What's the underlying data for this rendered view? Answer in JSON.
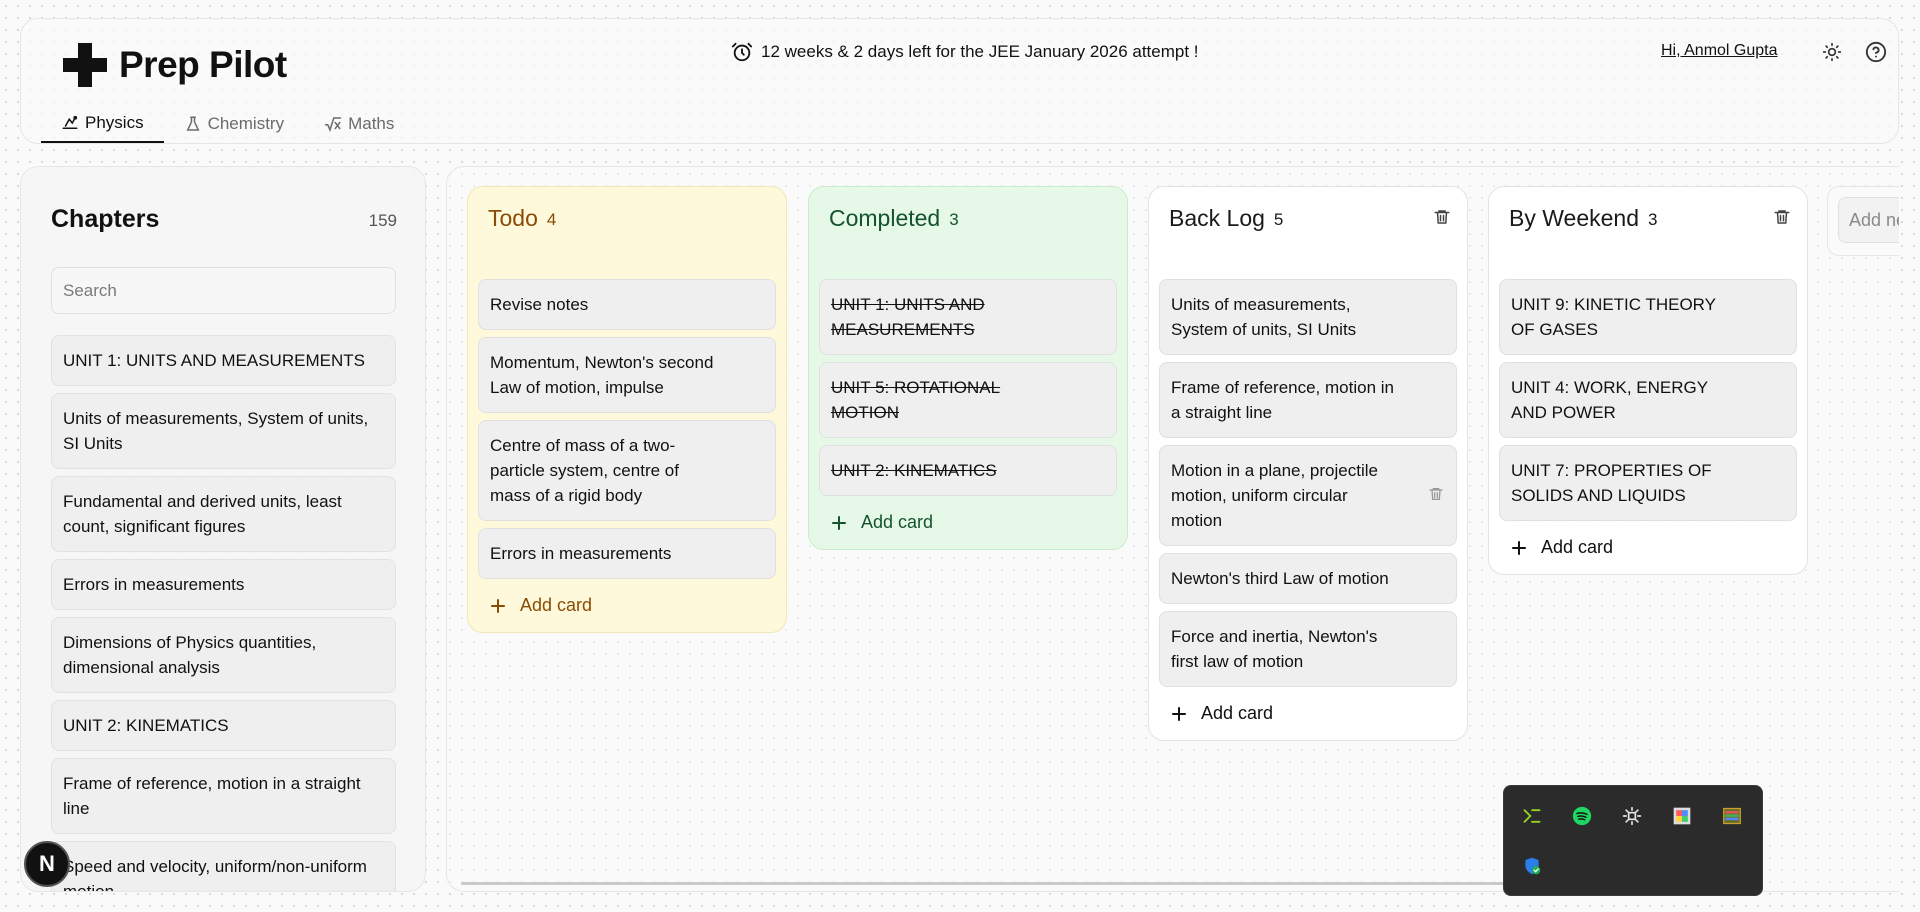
{
  "header": {
    "app_title": "Prep Pilot",
    "announcement": "12 weeks & 2 days left for the JEE January 2026 attempt !",
    "greeting": "Hi, Anmol Gupta"
  },
  "tabs": [
    {
      "label": "Physics",
      "icon": "physics-icon",
      "active": true
    },
    {
      "label": "Chemistry",
      "icon": "flask-icon",
      "active": false
    },
    {
      "label": "Maths",
      "icon": "sqrt-icon",
      "active": false
    }
  ],
  "sidebar": {
    "title": "Chapters",
    "count": "159",
    "search_placeholder": "Search",
    "items": [
      "UNIT 1: UNITS AND MEASUREMENTS",
      "Units of measurements, System of units, SI Units",
      "Fundamental and derived units, least count, significant figures",
      "Errors in measurements",
      "Dimensions of Physics quantities, dimensional analysis",
      "UNIT 2: KINEMATICS",
      "Frame of reference, motion in a straight line",
      "Speed and velocity, uniform/non-uniform motion"
    ]
  },
  "board": {
    "columns": [
      {
        "name": "Todo",
        "count": "4",
        "add_label": "Add card",
        "cards": [
          "Revise notes",
          "Momentum, Newton's second Law of motion, impulse",
          "Centre of mass of a two-particle system, centre of mass of a rigid body",
          "Errors in measurements"
        ]
      },
      {
        "name": "Completed",
        "count": "3",
        "add_label": "Add card",
        "cards": [
          "UNIT 1: UNITS AND MEASUREMENTS",
          "UNIT 5: ROTATIONAL MOTION",
          "UNIT 2: KINEMATICS"
        ]
      },
      {
        "name": "Back Log",
        "count": "5",
        "add_label": "Add card",
        "cards": [
          "Units of measurements, System of units, SI Units",
          "Frame of reference, motion in a straight line",
          "Motion in a plane, projectile motion, uniform circular motion",
          "Newton's third Law of motion",
          "Force and inertia, Newton's first law of motion"
        ]
      },
      {
        "name": "By Weekend",
        "count": "3",
        "add_label": "Add card",
        "cards": [
          "UNIT 9: KINETIC THEORY OF GASES",
          "UNIT 4: WORK, ENERGY AND POWER",
          "UNIT 7: PROPERTIES OF SOLIDS AND LIQUIDS"
        ]
      }
    ],
    "add_column_placeholder": "Add new column"
  },
  "dev_badge": "N",
  "colors": {
    "todo_bg": "#fff8d6",
    "todo_text": "#8a4b05",
    "completed_bg": "#e2f8e4",
    "completed_text": "#14532d",
    "tray_bg": "#2b2b2b"
  }
}
